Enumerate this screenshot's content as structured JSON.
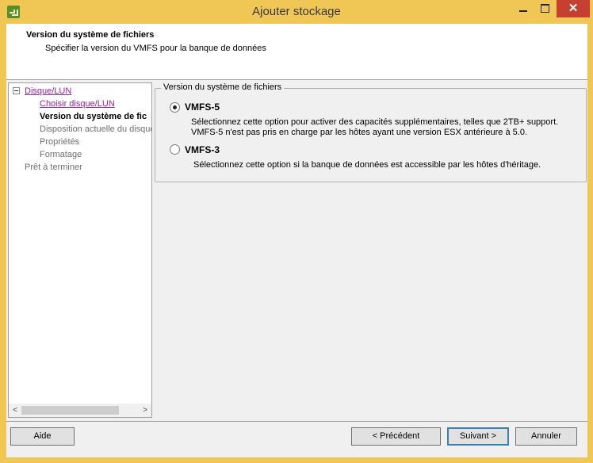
{
  "window": {
    "title": "Ajouter stockage",
    "close_glyph": "✕"
  },
  "header": {
    "title": "Version du système de fichiers",
    "subtitle": "Spécifier la version du VMFS pour la banque de données"
  },
  "tree": {
    "root_label": "Disque/LUN",
    "items": [
      {
        "label": "Choisir disque/LUN",
        "state": "visited"
      },
      {
        "label": "Version du système de fic",
        "state": "current"
      },
      {
        "label": "Disposition actuelle du disque",
        "state": "pending"
      },
      {
        "label": "Propriétés",
        "state": "pending"
      },
      {
        "label": "Formatage",
        "state": "pending"
      }
    ],
    "final_label": "Prêt à terminer",
    "scroll_left": "<",
    "scroll_right": ">"
  },
  "filesystem_group": {
    "legend": "Version du système de fichiers",
    "options": [
      {
        "label": "VMFS-5",
        "selected": true,
        "desc_line1": "Sélectionnez cette option pour activer des capacités supplémentaires, telles que 2TB+ support.",
        "desc_line2": "VMFS-5 n'est pas pris en charge par les hôtes ayant une version ESX antérieure à 5.0."
      },
      {
        "label": "VMFS-3",
        "selected": false,
        "desc_line1": "Sélectionnez cette option si la banque de données est accessible par les hôtes d'héritage."
      }
    ]
  },
  "footer": {
    "help": "Aide",
    "back": "< Précédent",
    "next": "Suivant >",
    "cancel": "Annuler"
  },
  "colors": {
    "titlebar": "#f0c655",
    "close_button": "#c7402f",
    "link": "#9a1fa3"
  }
}
